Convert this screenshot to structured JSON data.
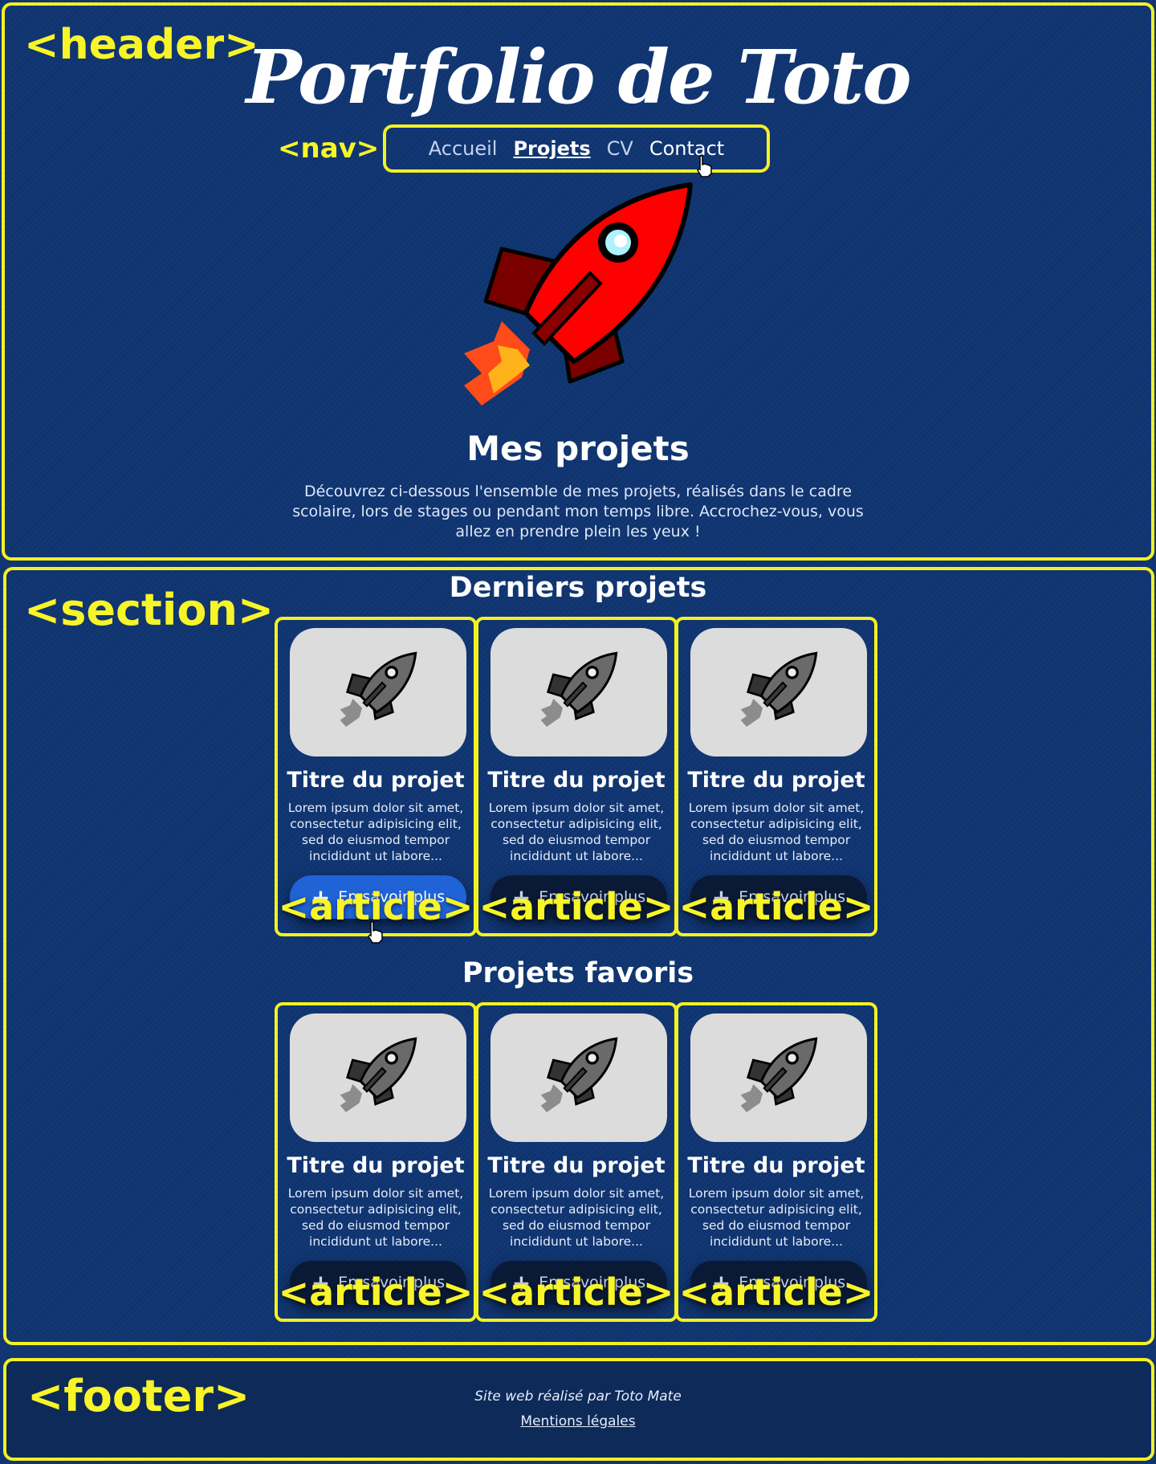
{
  "annotations": {
    "header_tag": "<header>",
    "nav_tag": "<nav>",
    "section_tag": "<section>",
    "footer_tag": "<footer>",
    "article_tag": "<article>"
  },
  "header": {
    "site_title": "Portfolio de Toto",
    "nav": [
      {
        "label": "Accueil",
        "state": "normal"
      },
      {
        "label": "Projets",
        "state": "active"
      },
      {
        "label": "CV",
        "state": "normal"
      },
      {
        "label": "Contact",
        "state": "hover"
      }
    ],
    "heading": "Mes projets",
    "intro": "Découvrez ci-dessous l'ensemble de mes projets, réalisés dans le cadre scolaire, lors de stages ou pendant mon temps libre. Accrochez-vous, vous allez en prendre plein les yeux !"
  },
  "sections": [
    {
      "title": "Derniers projets",
      "cards": [
        {
          "title": "Titre du projet",
          "desc": "Lorem ipsum dolor sit amet, consectetur adipisicing elit, sed do eiusmod tempor incididunt ut labore...",
          "button": "En savoir plus",
          "button_state": "hover"
        },
        {
          "title": "Titre du projet",
          "desc": "Lorem ipsum dolor sit amet, consectetur adipisicing elit, sed do eiusmod tempor incididunt ut labore...",
          "button": "En savoir plus",
          "button_state": "normal"
        },
        {
          "title": "Titre du projet",
          "desc": "Lorem ipsum dolor sit amet, consectetur adipisicing elit, sed do eiusmod tempor incididunt ut labore...",
          "button": "En savoir plus",
          "button_state": "normal"
        }
      ]
    },
    {
      "title": "Projets favoris",
      "cards": [
        {
          "title": "Titre du projet",
          "desc": "Lorem ipsum dolor sit amet, consectetur adipisicing elit, sed do eiusmod tempor incididunt ut labore...",
          "button": "En savoir plus",
          "button_state": "normal"
        },
        {
          "title": "Titre du projet",
          "desc": "Lorem ipsum dolor sit amet, consectetur adipisicing elit, sed do eiusmod tempor incididunt ut labore...",
          "button": "En savoir plus",
          "button_state": "normal"
        },
        {
          "title": "Titre du projet",
          "desc": "Lorem ipsum dolor sit amet, consectetur adipisicing elit, sed do eiusmod tempor incididunt ut labore...",
          "button": "En savoir plus",
          "button_state": "normal"
        }
      ]
    }
  ],
  "footer": {
    "credit": "Site web réalisé par Toto Mate",
    "legal_link": "Mentions légales"
  },
  "colors": {
    "background": "#0f3470",
    "annotation": "#f4f123",
    "button_primary": "#1f63d6",
    "button_dark": "#0a1a36",
    "footer_bg": "#0d2a58"
  },
  "icons": [
    "rocket-icon",
    "plus-icon",
    "hand-cursor-icon"
  ]
}
